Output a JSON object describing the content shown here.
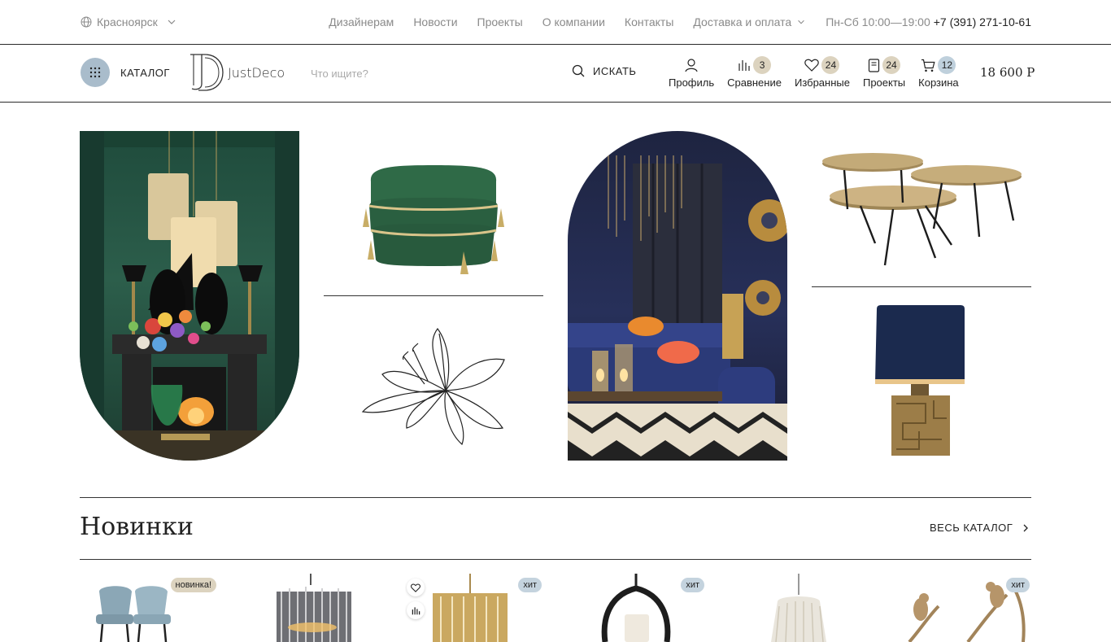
{
  "topbar": {
    "city": "Красноярск",
    "nav": [
      "Дизайнерам",
      "Новости",
      "Проекты",
      "О компании",
      "Контакты"
    ],
    "delivery": "Доставка и оплата",
    "hours": "Пн-Сб 10:00—19:00",
    "phone": "+7 (391) 271-10-61"
  },
  "header": {
    "catalog_label": "КАТАЛОГ",
    "logo_text": "JustDeco",
    "search_placeholder": "Что ищите?",
    "search_label": "ИСКАТЬ",
    "profile_label": "Профиль",
    "compare_label": "Сравнение",
    "compare_count": "3",
    "favorites_label": "Избранные",
    "favorites_count": "24",
    "projects_label": "Проекты",
    "projects_count": "24",
    "cart_label": "Корзина",
    "cart_count": "12",
    "cart_total": "18 600 Р"
  },
  "new_section": {
    "title": "Новинки",
    "all_link": "ВЕСЬ КАТАЛОГ",
    "products": [
      {
        "tag": "новинка!",
        "tag_type": "new"
      },
      {
        "tag": "",
        "tag_type": ""
      },
      {
        "tag": "хит",
        "tag_type": "hit"
      },
      {
        "tag": "хит",
        "tag_type": "hit"
      },
      {
        "tag": "",
        "tag_type": ""
      },
      {
        "tag": "хит",
        "tag_type": "hit"
      }
    ]
  },
  "colors": {
    "accent_blue": "#a9bccb",
    "badge_beige": "#dcd3bf",
    "badge_blue": "#bfd0dc",
    "tag_hit": "#c4d3de"
  }
}
